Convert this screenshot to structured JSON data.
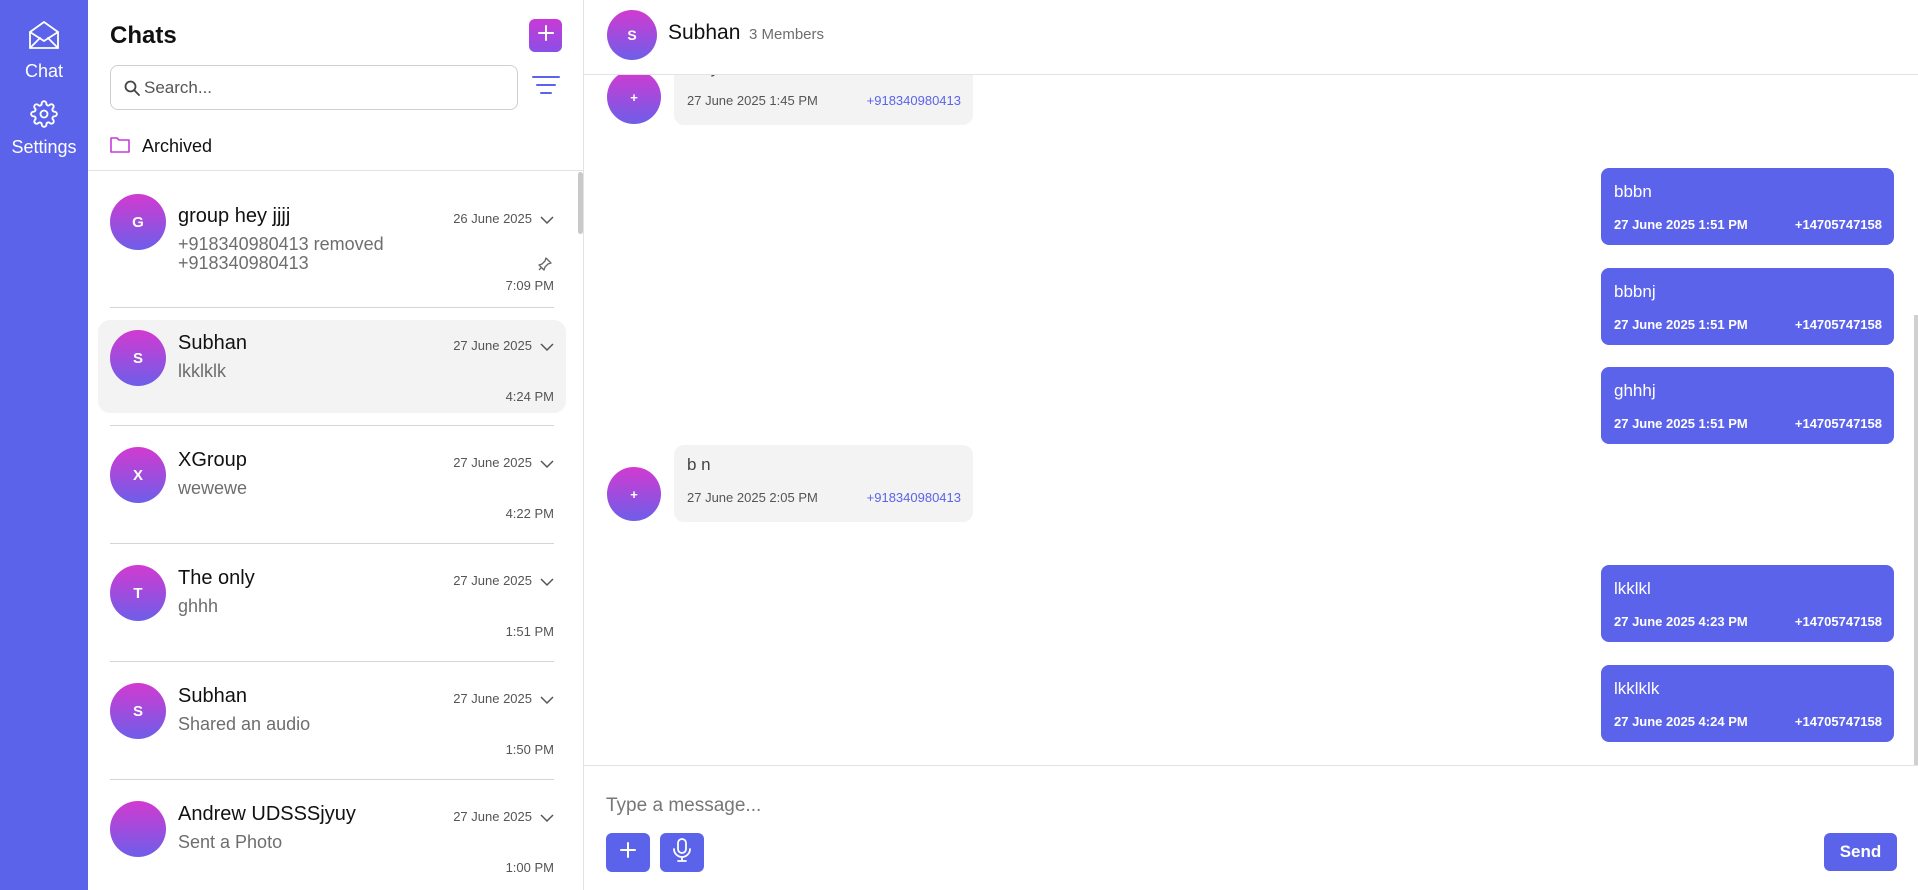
{
  "colors": {
    "accent": "#5b63ea",
    "avatar_top": "#d23ad0",
    "avatar_bottom": "#6d5ee9",
    "sender_link": "#5b63ea"
  },
  "rail": {
    "items": [
      {
        "label": "Chat",
        "icon": "mail-icon"
      },
      {
        "label": "Settings",
        "icon": "gear-icon"
      }
    ]
  },
  "sidebar": {
    "title": "Chats",
    "new_chat_icon": "plus-icon",
    "search": {
      "placeholder": "Search...",
      "value": ""
    },
    "filter_icon": "filter-icon",
    "archived_label": "Archived",
    "chats": [
      {
        "initial": "G",
        "name": "group hey jjjj",
        "date": "26 June 2025",
        "preview": "+918340980413 removed +918340980413",
        "time": "7:09 PM",
        "pinned": true
      },
      {
        "initial": "S",
        "name": "Subhan",
        "date": "27 June 2025",
        "preview": "lkklklk",
        "time": "4:24 PM",
        "active": true
      },
      {
        "initial": "X",
        "name": "XGroup",
        "date": "27 June 2025",
        "preview": "wewewe",
        "time": "4:22 PM"
      },
      {
        "initial": "T",
        "name": "The only",
        "date": "27 June 2025",
        "preview": "ghhh",
        "time": "1:51 PM"
      },
      {
        "initial": "S",
        "name": "Subhan",
        "date": "27 June 2025",
        "preview": "Shared an audio",
        "time": "1:50 PM"
      },
      {
        "initial": "",
        "name": "Andrew UDSSSjyuy",
        "date": "27 June 2025",
        "preview": "Sent a Photo",
        "time": "1:00 PM"
      }
    ]
  },
  "conversation": {
    "header": {
      "initial": "S",
      "name": "Subhan",
      "members": "3 Members"
    },
    "messages": [
      {
        "dir": "in",
        "avatar": "+",
        "text": "they",
        "timestamp": "27 June 2025 1:45 PM",
        "sender": "+918340980413"
      },
      {
        "dir": "out",
        "text": "bbbn",
        "timestamp": "27 June 2025 1:51 PM",
        "sender": "+14705747158"
      },
      {
        "dir": "out",
        "text": "bbbnj",
        "timestamp": "27 June 2025 1:51 PM",
        "sender": "+14705747158"
      },
      {
        "dir": "out",
        "text": "ghhhj",
        "timestamp": "27 June 2025 1:51 PM",
        "sender": "+14705747158"
      },
      {
        "dir": "in",
        "avatar": "+",
        "text": "b n",
        "timestamp": "27 June 2025 2:05 PM",
        "sender": "+918340980413"
      },
      {
        "dir": "out",
        "text": "lkklkl",
        "timestamp": "27 June 2025 4:23 PM",
        "sender": "+14705747158"
      },
      {
        "dir": "out",
        "text": "lkklklk",
        "timestamp": "27 June 2025 4:24 PM",
        "sender": "+14705747158"
      }
    ],
    "composer": {
      "placeholder": "Type a message...",
      "value": "",
      "attach_icon": "plus-icon",
      "mic_icon": "microphone-icon",
      "send_label": "Send"
    }
  }
}
